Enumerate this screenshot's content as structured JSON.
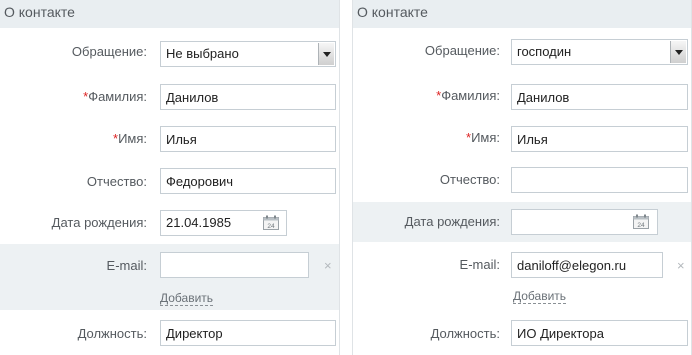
{
  "left": {
    "header": "О контакте",
    "salutation": {
      "label": "Обращение:",
      "value": "Не выбрано"
    },
    "last_name": {
      "star": "*",
      "label": "Фамилия:",
      "value": "Данилов"
    },
    "first_name": {
      "star": "*",
      "label": "Имя:",
      "value": "Илья"
    },
    "middle_name": {
      "label": "Отчество:",
      "value": "Федорович"
    },
    "birth_date": {
      "label": "Дата рождения:",
      "value": "21.04.1985",
      "calendar_day": "24"
    },
    "email": {
      "label": "E-mail:",
      "value": "",
      "clear": "×",
      "add": "Добавить"
    },
    "position": {
      "label": "Должность:",
      "value": "Директор"
    }
  },
  "right": {
    "header": "О контакте",
    "salutation": {
      "label": "Обращение:",
      "value": "господин"
    },
    "last_name": {
      "star": "*",
      "label": "Фамилия:",
      "value": "Данилов"
    },
    "first_name": {
      "star": "*",
      "label": "Имя:",
      "value": "Илья"
    },
    "middle_name": {
      "label": "Отчество:",
      "value": ""
    },
    "birth_date": {
      "label": "Дата рождения:",
      "value": "",
      "calendar_day": "24"
    },
    "email": {
      "label": "E-mail:",
      "value": "daniloff@elegon.ru",
      "clear": "×",
      "add": "Добавить"
    },
    "position": {
      "label": "Должность:",
      "value": "ИО Директора"
    }
  },
  "icons": {
    "calendar": "calendar-icon",
    "select_arrow": "chevron-down-icon",
    "clear": "close-icon"
  },
  "colors": {
    "required": "#dd2222",
    "highlight_row": "#edf1f3",
    "header_bg": "#e9eef1"
  }
}
